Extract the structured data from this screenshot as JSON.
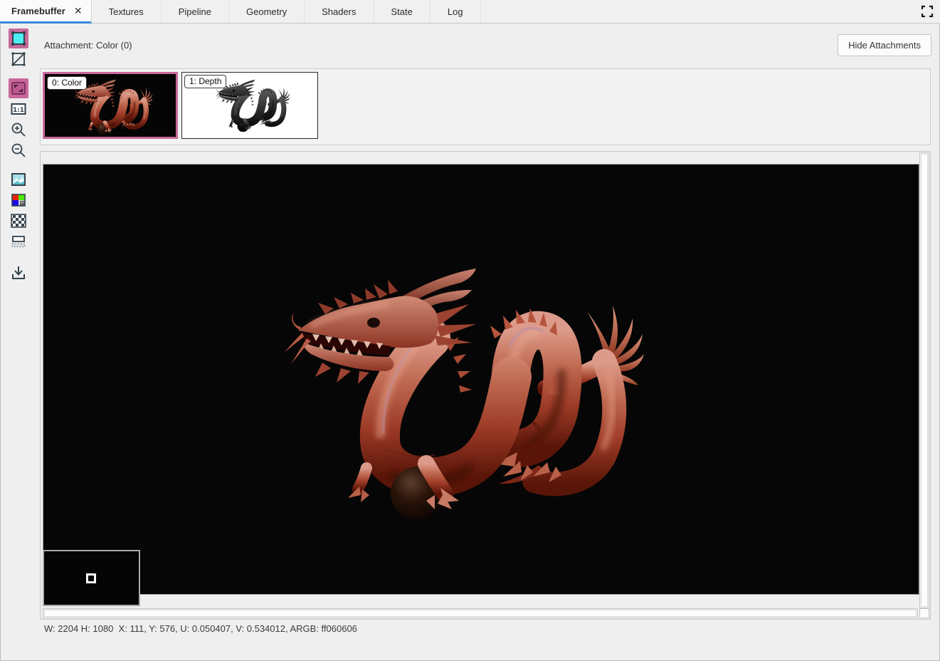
{
  "tabs": {
    "items": [
      {
        "label": "Framebuffer",
        "active": true,
        "closable": true
      },
      {
        "label": "Textures",
        "active": false
      },
      {
        "label": "Pipeline",
        "active": false
      },
      {
        "label": "Geometry",
        "active": false
      },
      {
        "label": "Shaders",
        "active": false
      },
      {
        "label": "State",
        "active": false
      },
      {
        "label": "Log",
        "active": false
      }
    ],
    "close_glyph": "✕"
  },
  "toolbar": {
    "buttons": [
      {
        "name": "display-mode",
        "selected": true
      },
      {
        "name": "wireframe-overlay",
        "selected": false
      },
      {
        "name": "zoom-fit",
        "selected": true
      },
      {
        "name": "zoom-1-1",
        "selected": false
      },
      {
        "name": "zoom-in",
        "selected": false
      },
      {
        "name": "zoom-out",
        "selected": false
      },
      {
        "name": "background-image",
        "selected": false
      },
      {
        "name": "rgba-channels",
        "selected": false
      },
      {
        "name": "checkerboard-background",
        "selected": false
      },
      {
        "name": "visible-range",
        "selected": false
      },
      {
        "name": "save-texture",
        "selected": false
      }
    ],
    "one_to_one_label": "1:1"
  },
  "header": {
    "attachment_label": "Attachment: Color (0)",
    "hide_attachments_label": "Hide Attachments"
  },
  "attachments": [
    {
      "label": "0: Color",
      "selected": true
    },
    {
      "label": "1: Depth",
      "selected": false
    }
  ],
  "status": {
    "text": "W: 2204 H: 1080  X: 111, Y: 576, U: 0.050407, V: 0.534012, ARGB: ff060606"
  },
  "colors": {
    "accent_blue": "#3b86e0",
    "selection_pink": "#c9699b",
    "render_background": "#060606",
    "depth_background": "#ffffff",
    "picked_argb": "ff060606"
  }
}
